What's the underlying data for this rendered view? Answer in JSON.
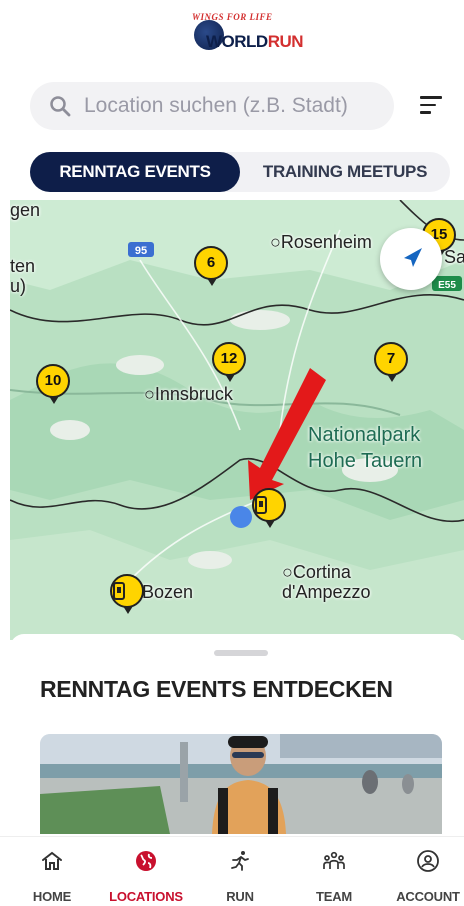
{
  "logo": {
    "top_text": "WINGS FOR LIFE",
    "main": "WORLD",
    "main_accent": "RUN"
  },
  "search": {
    "placeholder": "Location suchen (z.B. Stadt)"
  },
  "tabs": [
    {
      "label": "RENNTAG EVENTS",
      "active": true
    },
    {
      "label": "TRAINING MEETUPS",
      "active": false
    }
  ],
  "map": {
    "labels": {
      "gen": "gen",
      "ten": "ten",
      "u": "u)",
      "rosenheim": "Rosenheim",
      "sa": "Sa",
      "innsbruck": "Innsbruck",
      "np1": "Nationalpark",
      "np2": "Hohe Tauern",
      "bozen": "Bozen",
      "cortina1": "Cortina",
      "cortina2": "d'Ampezzo"
    },
    "road_signs": {
      "r95": "95",
      "e55": "E55"
    },
    "clusters": {
      "c6": "6",
      "c15": "15",
      "c12": "12",
      "c7": "7",
      "c10": "10"
    }
  },
  "sheet": {
    "title": "RENNTAG EVENTS ENTDECKEN"
  },
  "nav": [
    {
      "label": "HOME",
      "icon": "home-icon",
      "active": false
    },
    {
      "label": "LOCATIONS",
      "icon": "globe-icon",
      "active": true
    },
    {
      "label": "RUN",
      "icon": "runner-icon",
      "active": false
    },
    {
      "label": "TEAM",
      "icon": "team-icon",
      "active": false
    },
    {
      "label": "ACCOUNT",
      "icon": "account-icon",
      "active": false
    }
  ],
  "colors": {
    "navy": "#0e1e49",
    "accent": "#c8102e",
    "pin": "#ffd400",
    "arrow": "#e3191a"
  }
}
